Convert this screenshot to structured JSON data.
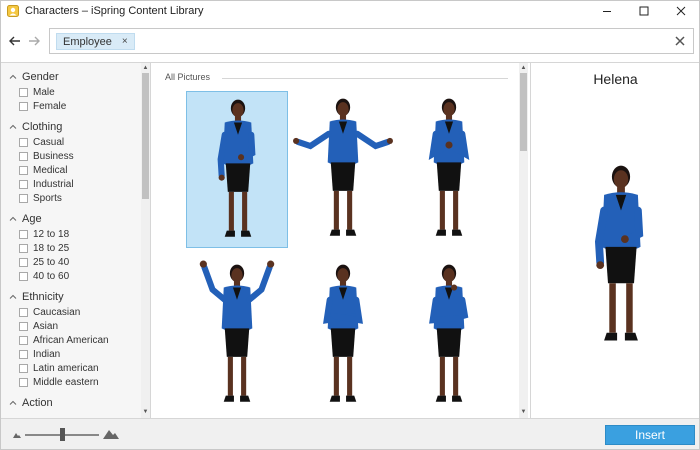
{
  "window": {
    "title": "Characters – iSpring Content Library"
  },
  "search": {
    "tag_label": "Employee",
    "tag_close": "×"
  },
  "filters": {
    "groups": [
      {
        "label": "Gender",
        "options": [
          "Male",
          "Female"
        ]
      },
      {
        "label": "Clothing",
        "options": [
          "Casual",
          "Business",
          "Medical",
          "Industrial",
          "Sports"
        ]
      },
      {
        "label": "Age",
        "options": [
          "12 to 18",
          "18 to 25",
          "25 to 40",
          "40 to 60"
        ]
      },
      {
        "label": "Ethnicity",
        "options": [
          "Caucasian",
          "Asian",
          "African American",
          "Indian",
          "Latin american",
          "Middle eastern"
        ]
      },
      {
        "label": "Action",
        "options": []
      }
    ]
  },
  "gallery": {
    "section_title": "All Pictures",
    "tiles": [
      {
        "pose": "hand-extended",
        "selected": true
      },
      {
        "pose": "shrug",
        "selected": false
      },
      {
        "pose": "holding-hand",
        "selected": false
      },
      {
        "pose": "arms-raised",
        "selected": false
      },
      {
        "pose": "arms-crossed",
        "selected": false
      },
      {
        "pose": "thinking",
        "selected": false
      }
    ]
  },
  "preview": {
    "name": "Helena"
  },
  "footer": {
    "insert_label": "Insert",
    "zoom_level": 0.5
  },
  "colors": {
    "jacket": "#2360b8",
    "skirt": "#111111",
    "skin": "#5a3220",
    "selection": "#c2e3f7",
    "accent": "#3aa0e0"
  }
}
